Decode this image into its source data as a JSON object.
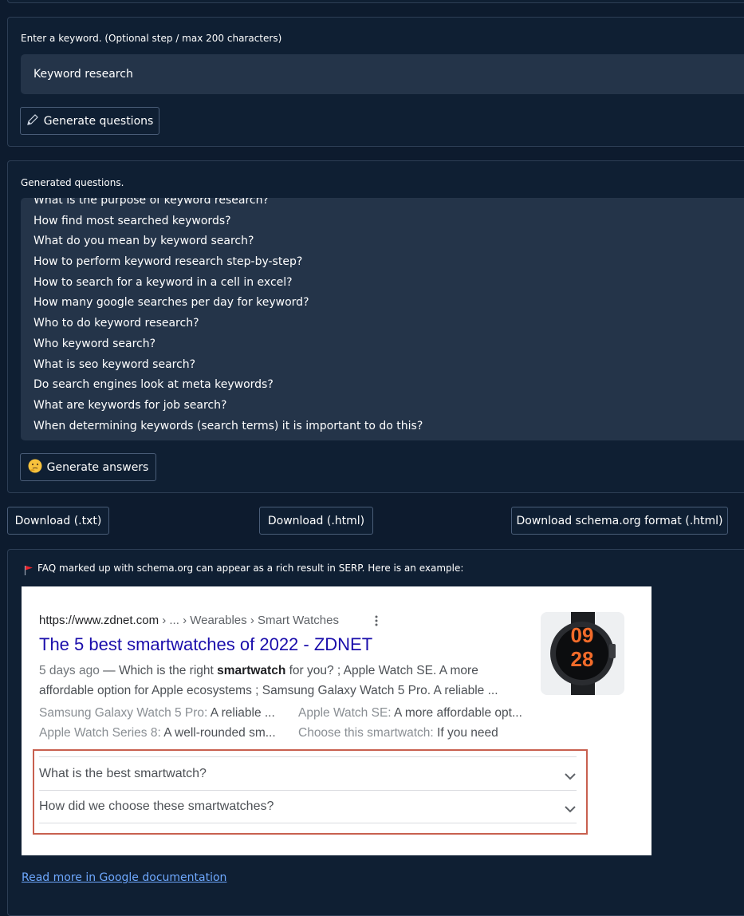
{
  "keyword_section": {
    "label": "Enter a keyword. (Optional step / max 200 characters)",
    "input_value": "Keyword research",
    "generate_button": "Generate questions",
    "pencil_icon": "✏️"
  },
  "questions_section": {
    "label": "Generated questions.",
    "questions": [
      "What is the purpose of keyword research?",
      "How find most searched keywords?",
      "What do you mean by keyword search?",
      "How to perform keyword research step-by-step?",
      "How to search for a keyword in a cell in excel?",
      "How many google searches per day for keyword?",
      "Who to do keyword research?",
      "Who keyword search?",
      "What is seo keyword search?",
      "Do search engines look at meta keywords?",
      "What are keywords for job search?",
      "When determining keywords (search terms) it is important to do this?"
    ],
    "generate_answers_button": "Generate answers",
    "thinking_icon": "🤔"
  },
  "downloads": {
    "txt": "Download (.txt)",
    "html": "Download (.html)",
    "schema": "Download schema.org format (.html)"
  },
  "faq_section": {
    "note": "FAQ marked up with schema.org can appear as a rich result in SERP. Here is an example:",
    "flag_color": "#e8232c",
    "example": {
      "url": "https://www.zdnet.com",
      "breadcrumb": " › ... › Wearables › Smart Watches",
      "title": "The 5 best smartwatches of 2022 - ZDNET",
      "date": "5 days ago",
      "snippet_pre": " — Which is the right ",
      "snippet_bold": "smartwatch",
      "snippet_post": " for you? ; Apple Watch SE. A more affordable option for Apple ecosystems ; Samsung Galaxy Watch 5 Pro. A reliable ...",
      "sitelinks": [
        {
          "name": "Samsung Galaxy Watch 5 Pro:",
          "desc": " A reliable ..."
        },
        {
          "name": "Apple Watch SE:",
          "desc": " A more affordable opt..."
        },
        {
          "name": "Apple Watch Series 8:",
          "desc": " A well-rounded sm..."
        },
        {
          "name": "Choose this smartwatch:",
          "desc": " If you need"
        }
      ],
      "faqs": [
        "What is the best smartwatch?",
        "How did we choose these smartwatches?"
      ],
      "thumbnail_text": "09\n28"
    },
    "doc_link": "Read more in Google documentation"
  }
}
